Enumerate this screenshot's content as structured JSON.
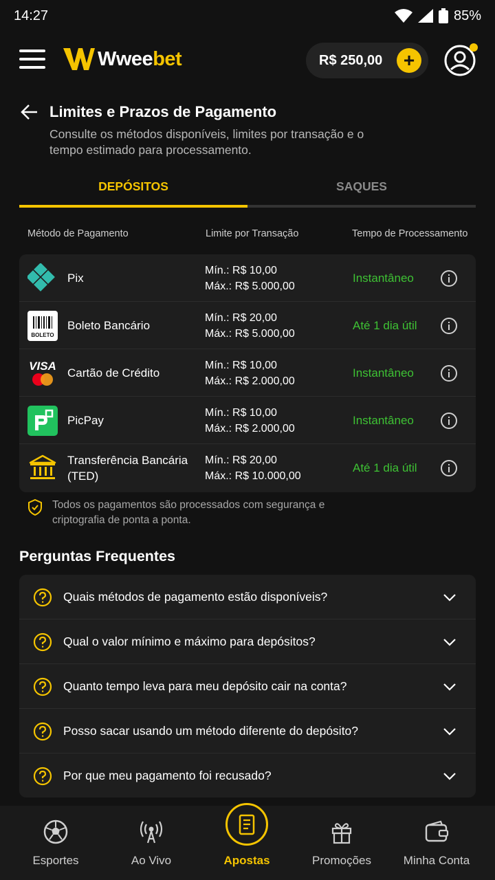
{
  "status_bar": {
    "time": "14:27",
    "battery": "85%"
  },
  "header": {
    "logo_text_a": "Wwee",
    "logo_text_b": "bet",
    "balance": "R$ 250,00",
    "add_label": "+"
  },
  "page": {
    "title": "Limites e Prazos de Pagamento",
    "subtitle": "Consulte os métodos disponíveis, limites por transação e o tempo estimado para processamento."
  },
  "tabs": [
    {
      "label": "DEPÓSITOS",
      "active": true
    },
    {
      "label": "SAQUES",
      "active": false
    }
  ],
  "table": {
    "headers": [
      "Método de Pagamento",
      "Limite por Transação",
      "Tempo de Processamento"
    ],
    "rows": [
      {
        "method": "Pix",
        "min": "Mín.: R$ 10,00",
        "max": "Máx.: R$ 5.000,00",
        "time": "Instantâneo",
        "icon": "pix-icon"
      },
      {
        "method": "Boleto Bancário",
        "min": "Mín.: R$ 20,00",
        "max": "Máx.: R$ 5.000,00",
        "time": "Até 1 dia útil",
        "icon": "boleto-icon",
        "icon_text": "BOLETO"
      },
      {
        "method": "Cartão de Crédito",
        "min": "Mín.: R$ 10,00",
        "max": "Máx.: R$ 2.000,00",
        "time": "Instantâneo",
        "icon": "visa-mastercard-icon",
        "icon_text": "VISA"
      },
      {
        "method": "PicPay",
        "min": "Mín.: R$ 10,00",
        "max": "Máx.: R$ 2.000,00",
        "time": "Instantâneo",
        "icon": "picpay-icon"
      },
      {
        "method": "Transferência Bancária (TED)",
        "min": "Mín.: R$ 20,00",
        "max": "Máx.: R$ 10.000,00",
        "time": "Até 1 dia útil",
        "icon": "bank-icon"
      }
    ]
  },
  "security_note": "Todos os pagamentos são processados com segurança e criptografia de ponta a ponta.",
  "faq": {
    "title": "Perguntas Frequentes",
    "items": [
      "Quais métodos de pagamento estão disponíveis?",
      "Qual o valor mínimo e máximo para depósitos?",
      "Quanto tempo leva para meu depósito cair na conta?",
      "Posso sacar usando um método diferente do depósito?",
      "Por que meu pagamento foi recusado?"
    ]
  },
  "bottom_nav": [
    {
      "label": "Esportes",
      "icon": "soccer-ball-icon"
    },
    {
      "label": "Ao Vivo",
      "icon": "broadcast-icon"
    },
    {
      "label": "Apostas",
      "icon": "bet-slip-icon",
      "active": true
    },
    {
      "label": "Promoções",
      "icon": "gift-icon"
    },
    {
      "label": "Minha Conta",
      "icon": "wallet-icon"
    }
  ],
  "colors": {
    "accent": "#f5c400",
    "success": "#3ec234",
    "background": "#121212",
    "card": "#1e1e1e"
  }
}
